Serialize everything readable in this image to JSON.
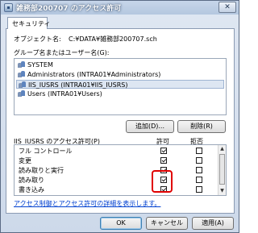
{
  "window": {
    "title": "雑務部200707 のアクセス許可",
    "close_glyph": "✕"
  },
  "tabs": [
    {
      "label": "セキュリティ"
    }
  ],
  "object": {
    "label": "オブジェクト名:",
    "value": "C:¥DATA¥雑務部200707.sch"
  },
  "groups": {
    "label": "グループ名またはユーザー名(G):",
    "items": [
      {
        "label": "SYSTEM",
        "icon": "users-icon",
        "selected": false
      },
      {
        "label": "Administrators (INTRA01¥Administrators)",
        "icon": "users-icon",
        "selected": false
      },
      {
        "label": "IIS_IUSRS (INTRA01¥IIS_IUSRS)",
        "icon": "users-icon",
        "selected": true
      },
      {
        "label": "Users (INTRA01¥Users)",
        "icon": "users-icon",
        "selected": false
      }
    ]
  },
  "buttons": {
    "add": "追加(D)...",
    "remove": "削除(R)",
    "ok": "OK",
    "cancel": "キャンセル",
    "apply": "適用(A)"
  },
  "permissions": {
    "header": "IIS_IUSRS のアクセス許可(P)",
    "allow_label": "許可",
    "deny_label": "拒否",
    "rows": [
      {
        "name": "フル コントロール",
        "allow": true,
        "deny": false
      },
      {
        "name": "変更",
        "allow": true,
        "deny": false
      },
      {
        "name": "読み取りと実行",
        "allow": true,
        "deny": false
      },
      {
        "name": "読み取り",
        "allow": true,
        "deny": false
      },
      {
        "name": "書き込み",
        "allow": true,
        "deny": false
      }
    ]
  },
  "help_link": "アクセス制御とアクセス許可の詳細を表示します。",
  "colors": {
    "highlight": "#e00000",
    "link": "#0040d0"
  }
}
